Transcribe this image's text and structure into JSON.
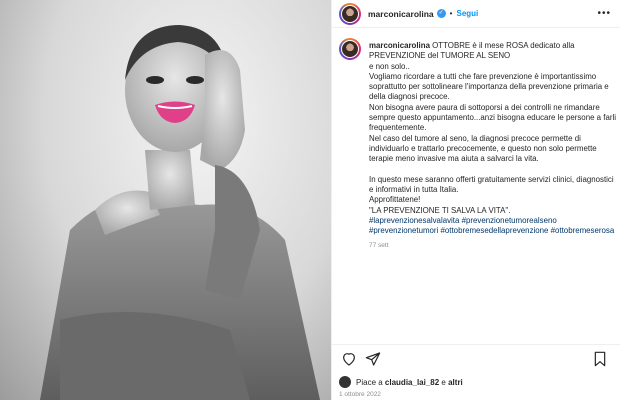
{
  "post": {
    "username": "marconicarolina",
    "verified_icon": "verified-badge-icon",
    "separator": "•",
    "follow_label": "Segui",
    "more_label": "•••"
  },
  "caption": {
    "username": "marconicarolina",
    "lines": [
      "OTTOBRE è il mese ROSA dedicato alla PREVENZIONE del TUMORE AL SENO",
      "e non solo..",
      "Vogliamo ricordare a tutti che fare prevenzione è importantissimo soprattutto per sottolineare l'importanza della prevenzione primaria e della diagnosi precoce.",
      "Non bisogna avere paura di sottoporsi a dei controlli ne rimandare sempre questo appuntamento...anzi bisogna educare le persone a farli frequentemente.",
      "Nel caso del tumore al seno, la diagnosi precoce permette di individuarlo e trattarlo precocemente, e questo non solo permette terapie meno invasive ma aiuta a salvarci la vita.",
      "In questo mese saranno offerti gratuitamente servizi clinici, diagnostici e informativi in tutta Italia.",
      "Approfittatene!",
      "\"LA PREVENZIONE TI SALVA LA VITA\"."
    ],
    "hashtags": [
      "#laprevenzionesalvalavita",
      "#prevenzionetumorealseno",
      "#prevenzionetumori",
      "#ottobremesedellaprevenzione",
      "#ottobremeserosa"
    ],
    "age": "77 sett"
  },
  "actions": {
    "like_icon": "heart-icon",
    "share_icon": "paper-plane-icon",
    "save_icon": "bookmark-icon"
  },
  "likes": {
    "prefix": "Piace a",
    "user": "claudia_lai_82",
    "middle": "e",
    "others": "altri"
  },
  "date": "1 ottobre 2022",
  "colors": {
    "link_blue": "#0095f6",
    "hashtag": "#00376b",
    "meta_gray": "#8e8e8e",
    "lips_pink": "#e0408a"
  }
}
